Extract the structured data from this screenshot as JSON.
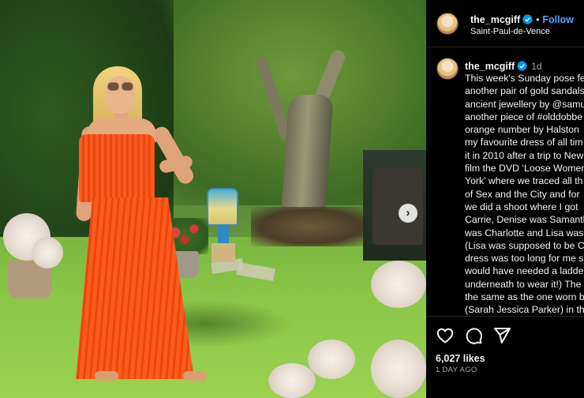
{
  "post": {
    "username": "the_mcgiff",
    "follow_label": "Follow",
    "location": "Saint-Paul-de-Vence",
    "time_short": "1d",
    "caption_lines": [
      "This week's Sunday pose fea",
      "another pair of gold sandals",
      "ancient jewellery by @samu",
      "another piece of #olddobbe",
      "orange number by Halston",
      "my favourite dress of all tim",
      "it in 2010 after a trip to New",
      "film the DVD ‘Loose Women",
      "York’ where we traced all th",
      "of Sex and the City and for",
      "we did a shoot where I got",
      "Carrie, Denise was Samanth",
      "was Charlotte and Lisa was",
      "(Lisa was supposed to be Ca",
      "dress was too long for me s",
      "would have needed a ladde",
      "underneath to wear it!) The",
      "the same as the one worn b",
      "(Sarah Jessica Parker) in the"
    ],
    "likes": "6,027 likes",
    "posted_ago": "1 DAY AGO"
  },
  "icons": {
    "verified": "verified-badge-icon",
    "like": "heart-icon",
    "comment": "comment-bubble-icon",
    "share": "paper-plane-icon",
    "next": "chevron-right-icon"
  },
  "colors": {
    "accent": "#4aa8ff",
    "background": "#000000",
    "muted": "#a8a8a8",
    "dress": "#ff5a1f"
  }
}
